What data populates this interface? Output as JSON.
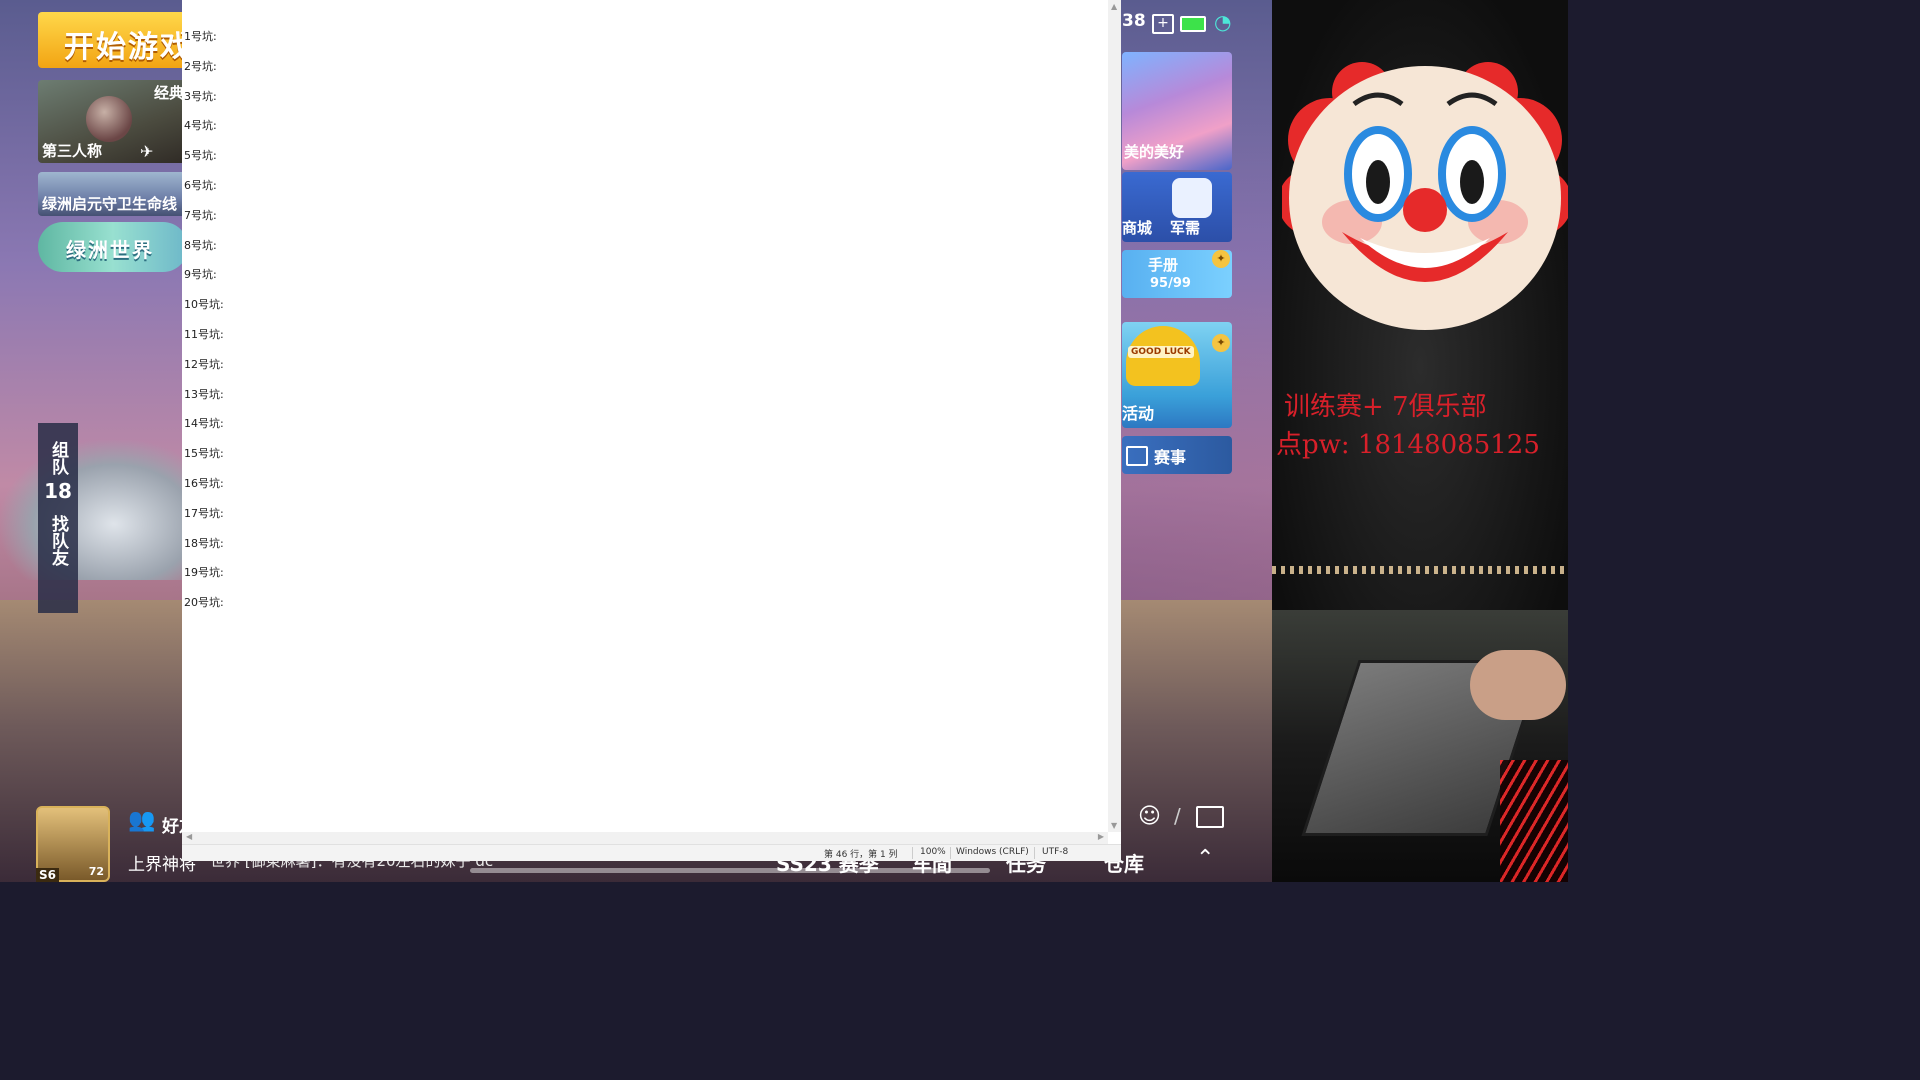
{
  "game": {
    "start_button": "开始游戏",
    "mode_card": {
      "classic": "经典",
      "third_person": "第三人称"
    },
    "oasis_card": "绿洲启元守卫生命线",
    "world_card": "绿洲世界",
    "team_side": {
      "line1": "组队",
      "count": "18",
      "line2": "找队友"
    },
    "avatar": {
      "tier": "S6",
      "level": "72"
    },
    "friends_label": "好友",
    "bottom": {
      "rank_label": "上界神将",
      "chat_message": "世界 [御東麻薯]：有没有20左右的妹子 dc",
      "season_tab": "SS23 赛季",
      "vehicle_tab": "车間",
      "task_tab": "任务",
      "warehouse_tab": "仓库"
    },
    "status": {
      "time": "38"
    },
    "banner_text": "美的美好",
    "mall_label": "商城",
    "supply_label": "军需",
    "handbook": {
      "title": "手册",
      "progress": "95/99"
    },
    "luck_badge": "GOOD LUCK",
    "activity_label": "活动",
    "events_label": "赛事"
  },
  "notepad": {
    "lines": [
      "1号坑:",
      "2号坑:",
      "3号坑:",
      "4号坑:",
      "5号坑:",
      "6号坑:",
      "7号坑:",
      "8号坑:",
      "9号坑:",
      "10号坑:",
      "11号坑:",
      "12号坑:",
      "13号坑:",
      "14号坑:",
      "15号坑:",
      "16号坑:",
      "17号坑:",
      "18号坑:",
      "19号坑:",
      "20号坑:"
    ],
    "status": {
      "position": "第 46 行，第 1 列",
      "zoom": "100%",
      "line_ending": "Windows (CRLF)",
      "encoding": "UTF-8"
    }
  },
  "stream": {
    "promo_line1": "训练赛+   7俱乐部",
    "promo_line2": "点pw:  18148085125"
  }
}
